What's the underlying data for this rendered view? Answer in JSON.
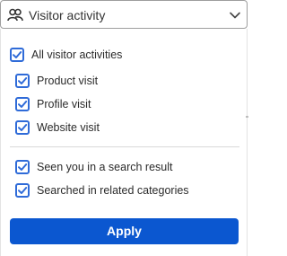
{
  "dropdown": {
    "label": "Visitor activity",
    "icon": "people-icon",
    "chevron": "chevron-down-icon"
  },
  "options": [
    {
      "label": "All visitor activities",
      "checked": true
    },
    {
      "label": "Product visit",
      "checked": true
    },
    {
      "label": "Profile visit",
      "checked": true
    },
    {
      "label": "Website visit",
      "checked": true
    },
    {
      "label": "Seen you in a search result",
      "checked": true
    },
    {
      "label": "Searched in related categories",
      "checked": true
    }
  ],
  "actions": {
    "apply_label": "Apply"
  },
  "colors": {
    "accent": "#0b57d0",
    "checkbox": "#2f6bd8",
    "divider": "#d9d9d9"
  }
}
